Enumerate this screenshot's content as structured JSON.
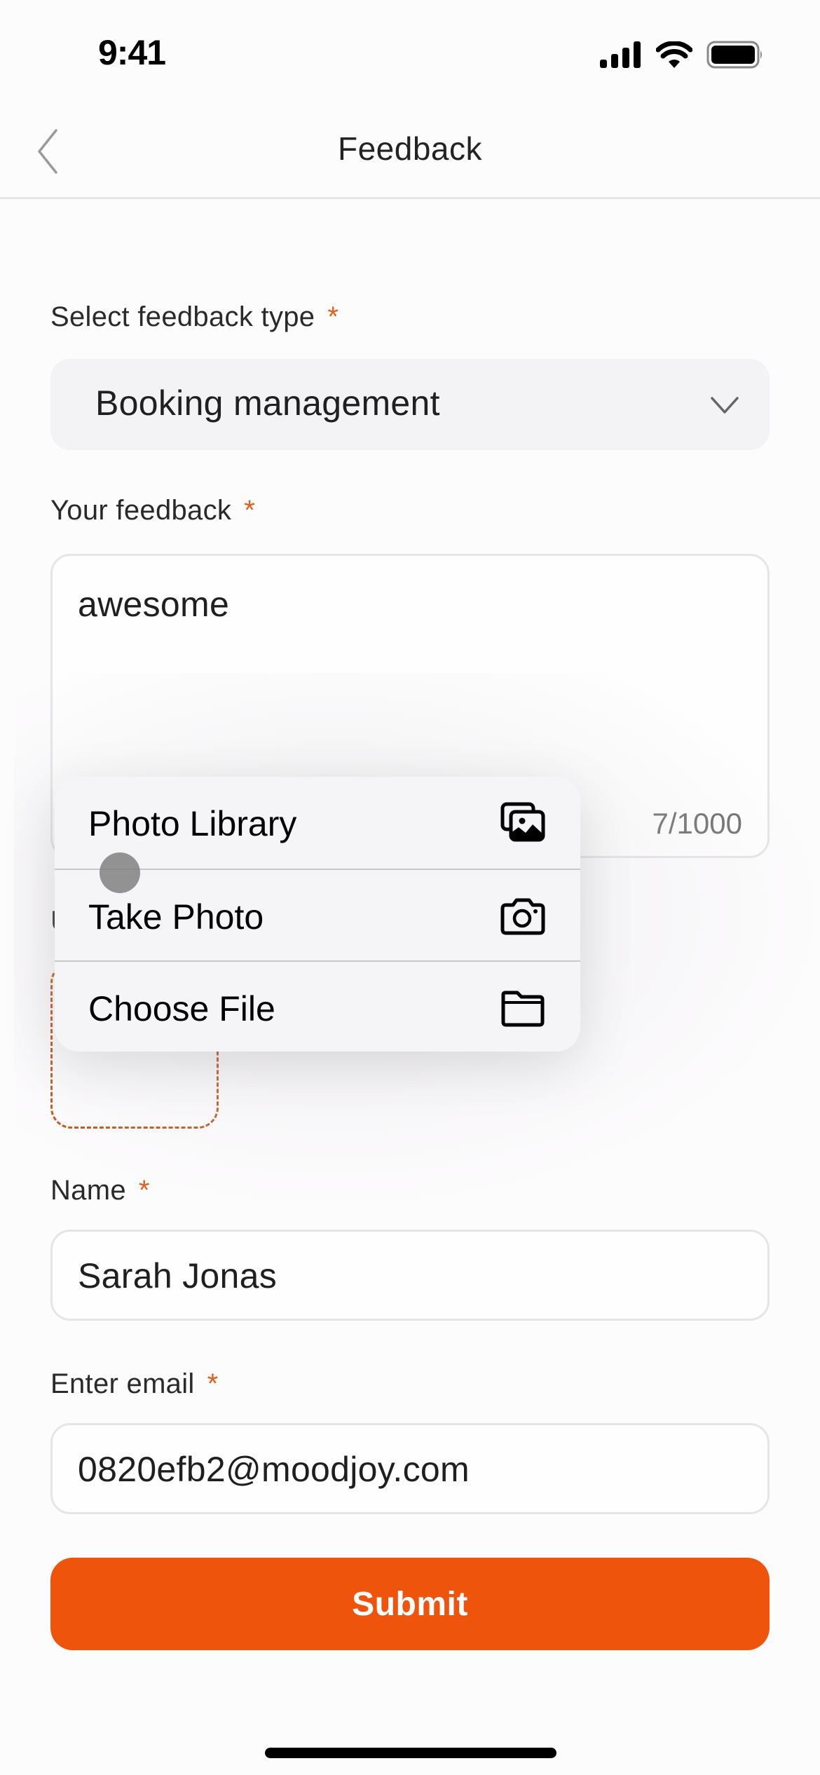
{
  "status_bar": {
    "time": "9:41",
    "icons": [
      "cellular-signal-icon",
      "wifi-icon",
      "battery-icon"
    ]
  },
  "nav": {
    "back_icon": "chevron-left-icon",
    "title": "Feedback"
  },
  "form": {
    "feedback_type": {
      "label": "Select feedback type",
      "required_mark": "*",
      "value": "Booking management",
      "icon": "chevron-down-icon"
    },
    "feedback": {
      "label": "Your feedback",
      "required_mark": "*",
      "value": "awesome",
      "char_count": "7/1000"
    },
    "upload": {
      "label_visible": "U",
      "icon": "plus-icon"
    },
    "name": {
      "label": "Name",
      "required_mark": "*",
      "value": "Sarah Jonas"
    },
    "email": {
      "label": "Enter email",
      "required_mark": "*",
      "value": "0820efb2@moodjoy.com"
    },
    "submit_label": "Submit"
  },
  "attachment_menu": {
    "items": [
      {
        "label": "Photo Library",
        "icon": "photo-library-icon"
      },
      {
        "label": "Take Photo",
        "icon": "camera-icon"
      },
      {
        "label": "Choose File",
        "icon": "folder-icon"
      }
    ]
  },
  "colors": {
    "accent": "#ee540b",
    "required_asterisk": "#e0601a",
    "dashed_border": "#c3551c",
    "field_background": "#f3f2f5",
    "page_background": "#fdfcfd"
  }
}
